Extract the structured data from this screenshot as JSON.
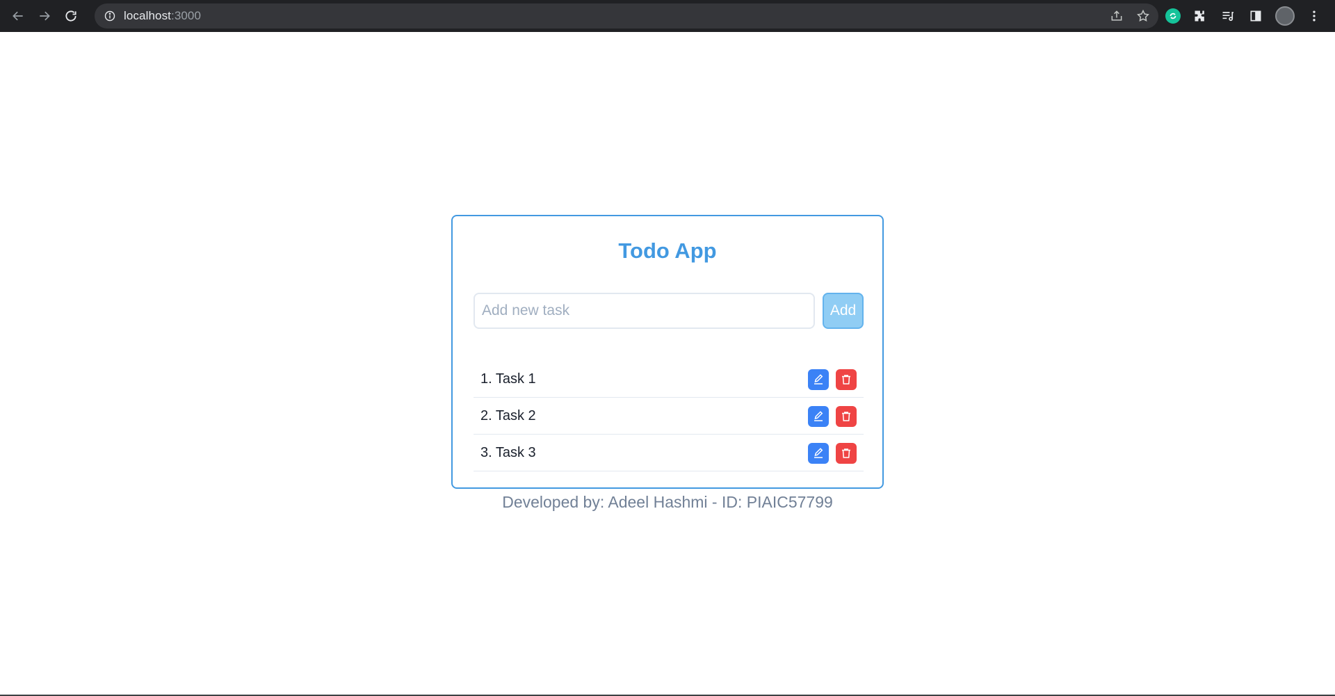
{
  "browser": {
    "url_host": "localhost",
    "url_port": ":3000"
  },
  "app": {
    "title": "Todo App",
    "input": {
      "placeholder": "Add new task",
      "value": ""
    },
    "add_label": "Add",
    "tasks": [
      {
        "text": "1. Task 1"
      },
      {
        "text": "2. Task 2"
      },
      {
        "text": "3. Task 3"
      }
    ],
    "footer": "Developed by: Adeel Hashmi - ID: PIAIC57799"
  },
  "colors": {
    "accent": "#4299e1",
    "edit": "#3b82f6",
    "delete": "#ef4444",
    "footer_text": "#718096"
  },
  "icons": {
    "edit": "pencil-icon",
    "delete": "trash-icon"
  }
}
